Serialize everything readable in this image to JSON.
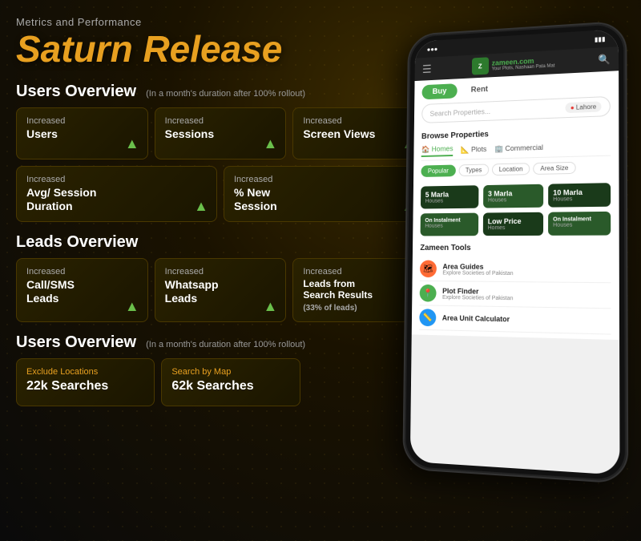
{
  "header": {
    "subtitle": "Metrics and Performance",
    "title": "Saturn Release"
  },
  "users_overview": {
    "title": "Users Overview",
    "subtitle": "(In a month's duration after 100% rollout)",
    "cards_row1": [
      {
        "label": "Increased",
        "value": "Users"
      },
      {
        "label": "Increased",
        "value": "Sessions"
      },
      {
        "label": "Increased",
        "value": "Screen Views"
      }
    ],
    "cards_row2": [
      {
        "label": "Increased",
        "value": "Avg/ Session\nDuration"
      },
      {
        "label": "Increased",
        "value": "% New\nSession"
      }
    ]
  },
  "leads_overview": {
    "title": "Leads Overview",
    "cards": [
      {
        "label": "Increased",
        "value": "Call/SMS\nLeads"
      },
      {
        "label": "Increased",
        "value": "Whatsapp\nLeads"
      },
      {
        "label": "Increased",
        "value": "Leads from\nSearch Results\n(33% of leads)"
      }
    ]
  },
  "users_overview2": {
    "title": "Users Overview",
    "subtitle": "(In a month's duration after 100% rollout)",
    "cards": [
      {
        "label": "Exclude Locations",
        "value": "22k Searches"
      },
      {
        "label": "Search by Map",
        "value": "62k Searches"
      }
    ]
  },
  "phone": {
    "zameen_name": "zameen.com",
    "zameen_tagline": "Your Plots, Nashaan Pata Mat",
    "tab_buy": "Buy",
    "tab_rent": "Rent",
    "search_placeholder": "Search Properties...",
    "location": "Lahore",
    "browse_title": "Browse Properties",
    "tabs": [
      "Homes",
      "Plots",
      "Commercial"
    ],
    "filters": [
      "Popular",
      "Types",
      "Location",
      "Area Size"
    ],
    "properties": [
      {
        "size": "5 Marla",
        "type": "Houses"
      },
      {
        "size": "3 Marla",
        "type": "Houses"
      },
      {
        "size": "10 Marla",
        "type": "Houses"
      },
      {
        "size": "On Instalment",
        "type": "Houses"
      },
      {
        "size": "Low Price",
        "type": "Homes"
      },
      {
        "size": "On Instalment",
        "type": "Houses"
      }
    ],
    "tools_title": "Zameen Tools",
    "tools": [
      {
        "name": "Area Guides",
        "desc": "Explore Societies of Pakistan",
        "color": "#ff6b35"
      },
      {
        "name": "Plot Finder",
        "desc": "Explore Societies of Pakistan",
        "color": "#4CAF50"
      },
      {
        "name": "Area Unit Calculator",
        "desc": "",
        "color": "#2196F3"
      }
    ]
  }
}
